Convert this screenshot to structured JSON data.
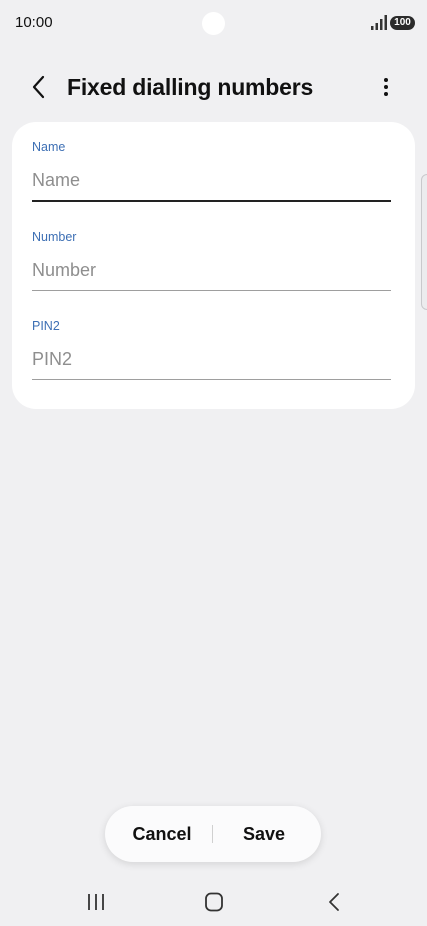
{
  "status_bar": {
    "time": "10:00",
    "battery": "100"
  },
  "header": {
    "title": "Fixed dialling numbers"
  },
  "form": {
    "fields": [
      {
        "label": "Name",
        "placeholder": "Name",
        "value": ""
      },
      {
        "label": "Number",
        "placeholder": "Number",
        "value": ""
      },
      {
        "label": "PIN2",
        "placeholder": "PIN2",
        "value": ""
      }
    ]
  },
  "actions": {
    "cancel_label": "Cancel",
    "save_label": "Save"
  },
  "colors": {
    "background": "#f0f0f2",
    "card": "#ffffff",
    "label_blue": "#3d6fb4"
  },
  "icons": {
    "back": "chevron-left-icon",
    "more": "vertical-dots-icon",
    "signal": "signal-bars-icon",
    "nav_recents": "recents-icon",
    "nav_home": "home-icon",
    "nav_back": "nav-back-icon"
  }
}
